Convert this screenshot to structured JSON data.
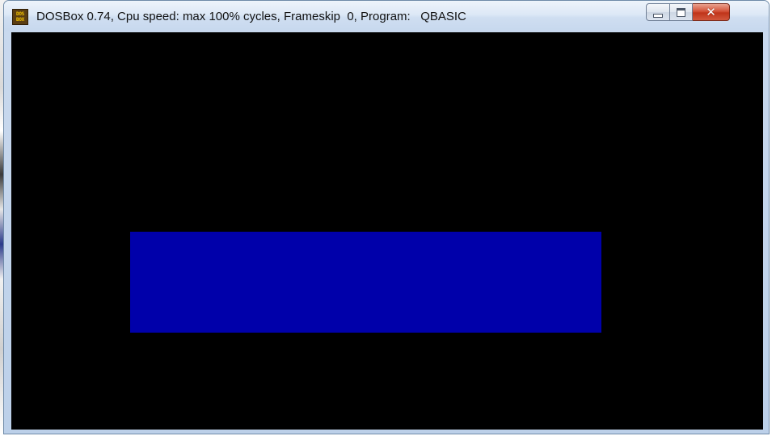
{
  "window": {
    "title": "DOSBox 0.74, Cpu speed: max 100% cycles, Frameskip  0, Program:   QBASIC",
    "icon": {
      "name": "dosbox-icon",
      "line1": "DOS",
      "line2": "BOX"
    },
    "controls": {
      "close_glyph": "✕"
    }
  },
  "screen": {
    "background_color": "#000000",
    "drawn_rectangle_color": "#0000aa"
  }
}
